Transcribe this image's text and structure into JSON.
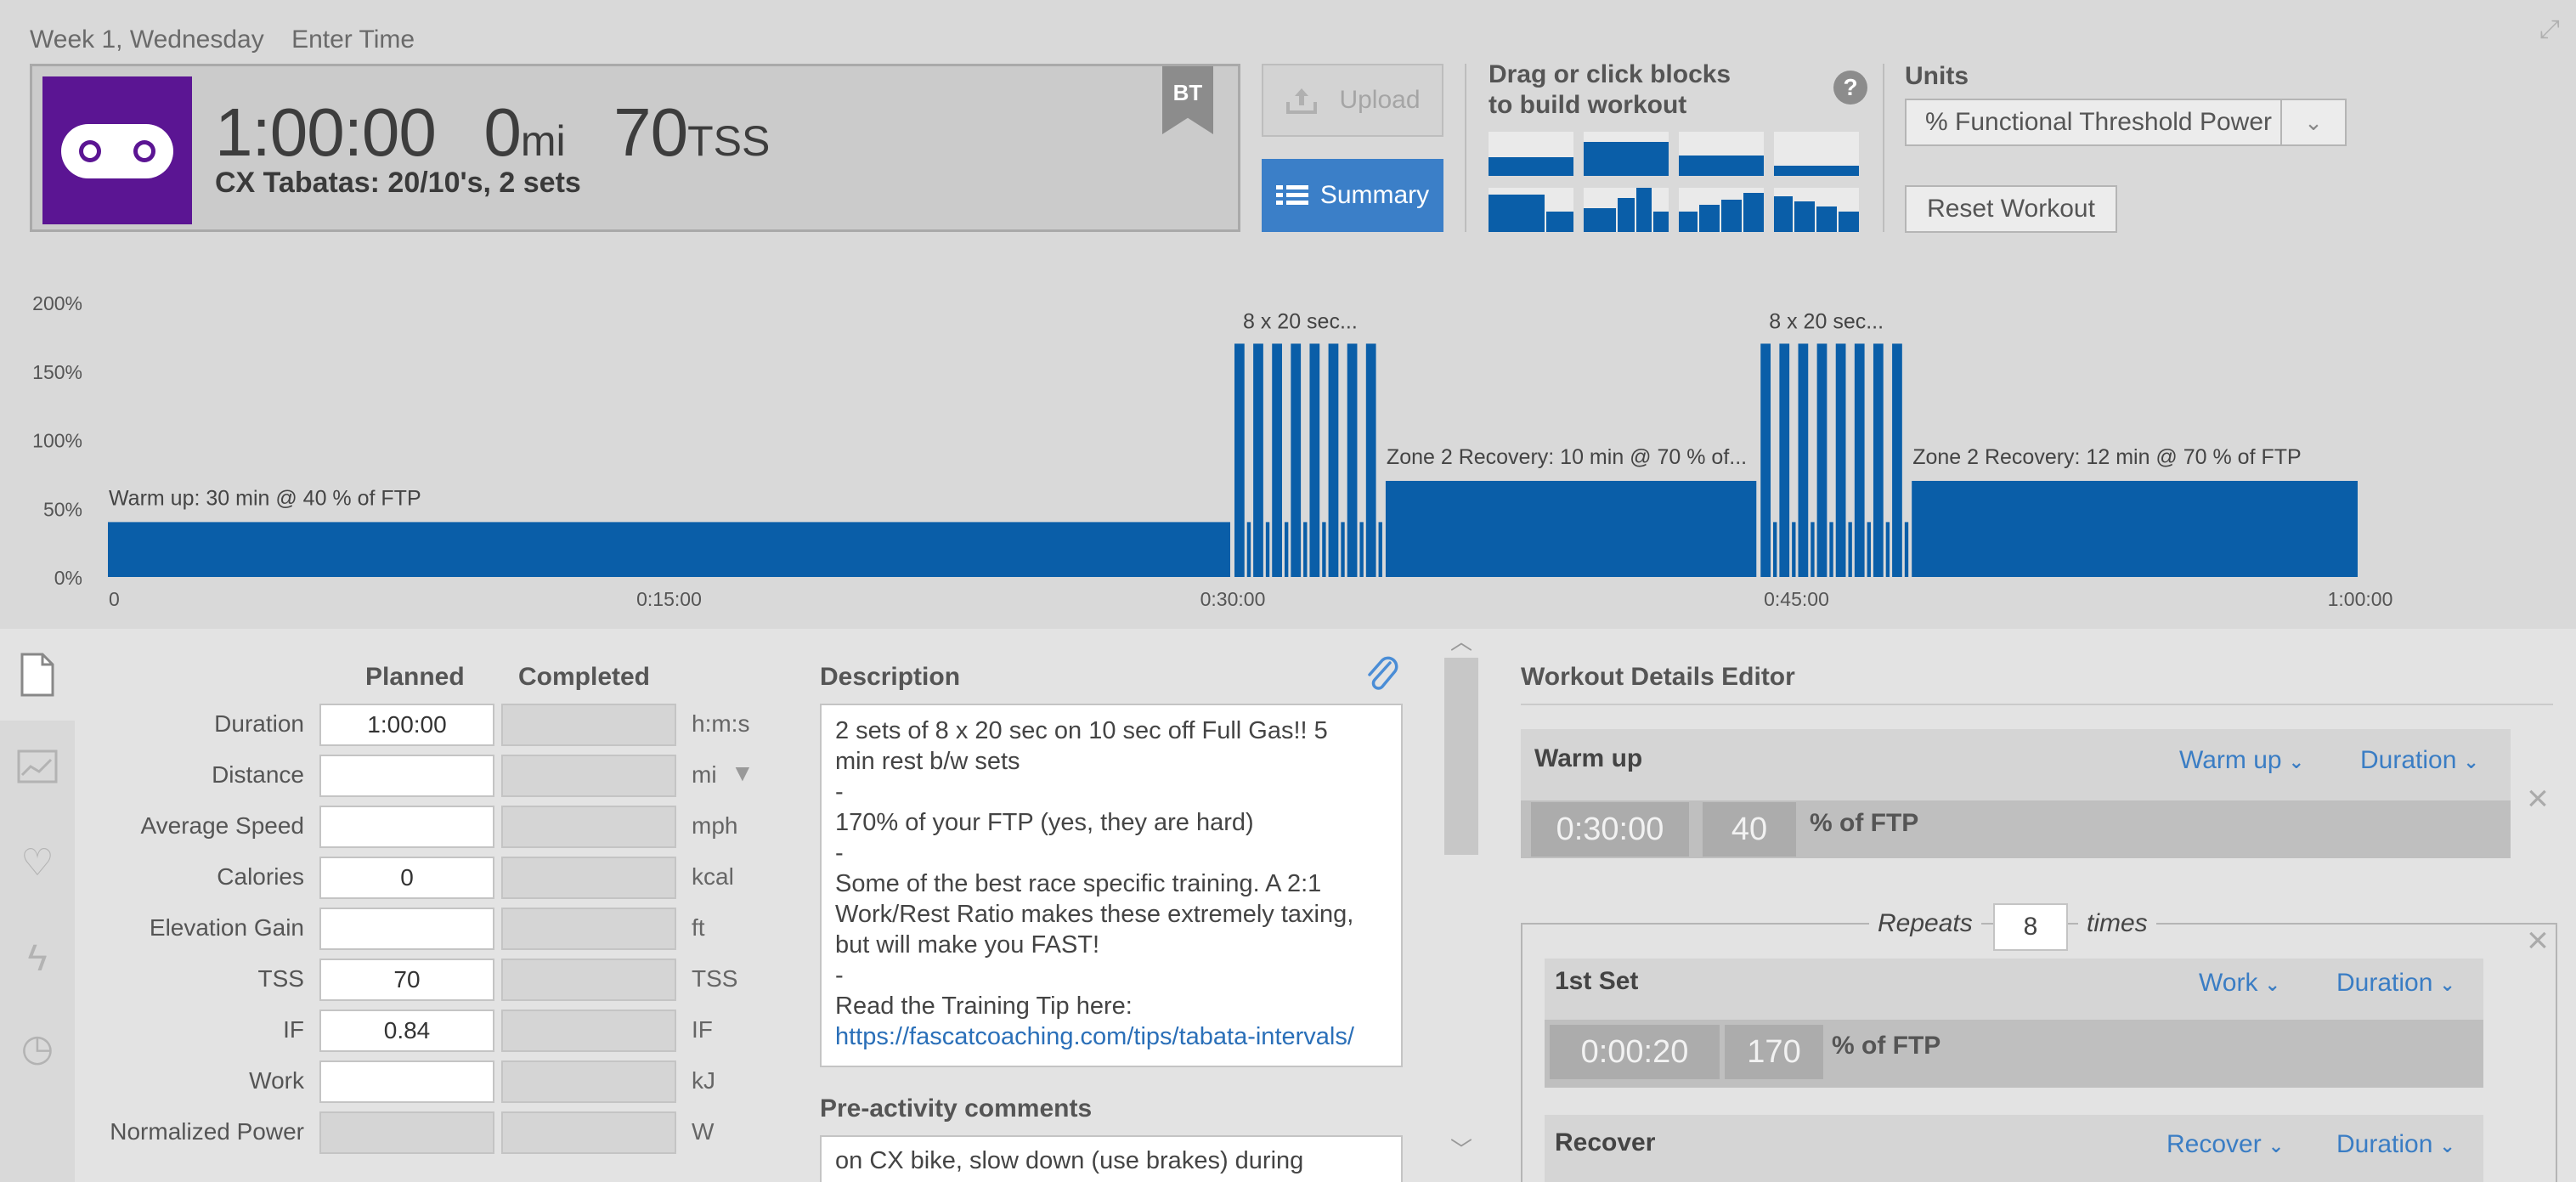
{
  "breadcrumb": {
    "day": "Week 1, Wednesday",
    "action": "Enter Time"
  },
  "workout": {
    "duration": "1:00:00",
    "distance": "0",
    "distance_unit": "mi",
    "tss": "70",
    "tss_unit": "TSS",
    "title": "CX Tabatas: 20/10's, 2 sets",
    "flag": "BT",
    "sport_icon": "bike-chain-icon",
    "sport_color": "#5b1593"
  },
  "toolbar": {
    "upload_label": "Upload",
    "summary_label": "Summary"
  },
  "builder": {
    "label_line1": "Drag or click blocks",
    "label_line2": "to build workout",
    "help": "?"
  },
  "units": {
    "label": "Units",
    "selected": "% Functional Threshold Power",
    "reset_label": "Reset Workout"
  },
  "chart_data": {
    "type": "bar",
    "y_ticks": [
      "200%",
      "150%",
      "100%",
      "50%",
      "0%"
    ],
    "x_ticks": [
      "0",
      "0:15:00",
      "0:30:00",
      "0:45:00",
      "1:00:00"
    ],
    "ylim": [
      0,
      200
    ],
    "xlim_minutes": [
      0,
      60
    ],
    "segments": [
      {
        "label": "Warm up: 30 min @ 40 % of FTP",
        "start": 0,
        "end": 30,
        "value": 40
      },
      {
        "label": "8 x 20 sec...",
        "start": 30,
        "end": 34,
        "value": 170,
        "repeat": 8,
        "work": 20,
        "rest": 10,
        "rest_value": 40
      },
      {
        "label": "Zone 2 Recovery: 10 min @ 70 % of...",
        "start": 34,
        "end": 44,
        "value": 70
      },
      {
        "label": "8 x 20 sec...",
        "start": 44,
        "end": 48,
        "value": 170,
        "repeat": 8,
        "work": 20,
        "rest": 10,
        "rest_value": 40
      },
      {
        "label": "Zone 2 Recovery: 12 min @ 70 % of FTP",
        "start": 48,
        "end": 60,
        "value": 70
      }
    ],
    "color": "#0a5ea8"
  },
  "summary": {
    "col_planned": "Planned",
    "col_completed": "Completed",
    "rows": [
      {
        "label": "Duration",
        "planned": "1:00:00",
        "completed": "",
        "unit": "h:m:s"
      },
      {
        "label": "Distance",
        "planned": "",
        "completed": "",
        "unit": "mi"
      },
      {
        "label": "Average Speed",
        "planned": "",
        "completed": "",
        "unit": "mph"
      },
      {
        "label": "Calories",
        "planned": "0",
        "completed": "",
        "unit": "kcal"
      },
      {
        "label": "Elevation Gain",
        "planned": "",
        "completed": "",
        "unit": "ft"
      },
      {
        "label": "TSS",
        "planned": "70",
        "completed": "",
        "unit": "TSS"
      },
      {
        "label": "IF",
        "planned": "0.84",
        "completed": "",
        "unit": "IF"
      },
      {
        "label": "Work",
        "planned": "",
        "completed": "",
        "unit": "kJ"
      },
      {
        "label": "Normalized Power",
        "planned": "",
        "completed": "",
        "unit": "W"
      }
    ]
  },
  "description": {
    "heading": "Description",
    "text": "2 sets of 8 x 20 sec on 10 sec off Full Gas!! 5\nmin rest b/w sets\n-\n170% of your FTP (yes, they are hard)\n-\nSome of the best race specific training. A 2:1\nWork/Rest Ratio makes these extremely taxing,\nbut will make you FAST!\n-\nRead the Training Tip here:",
    "link": "https://fascatcoaching.com/tips/tabata-intervals/"
  },
  "pre_activity": {
    "heading": "Pre-activity comments",
    "text": "on CX bike, slow down (use brakes) during"
  },
  "editor": {
    "heading": "Workout Details Editor",
    "warmup": {
      "title": "Warm up",
      "type": "Warm up",
      "mode": "Duration",
      "duration": "0:30:00",
      "intensity": "40",
      "unit": "% of FTP"
    },
    "repeats": {
      "label": "Repeats",
      "count": "8",
      "suffix": "times"
    },
    "set1": {
      "title": "1st Set",
      "type": "Work",
      "mode": "Duration",
      "duration": "0:00:20",
      "intensity": "170",
      "unit": "% of FTP"
    },
    "recover": {
      "title": "Recover",
      "type": "Recover",
      "mode": "Duration"
    }
  }
}
